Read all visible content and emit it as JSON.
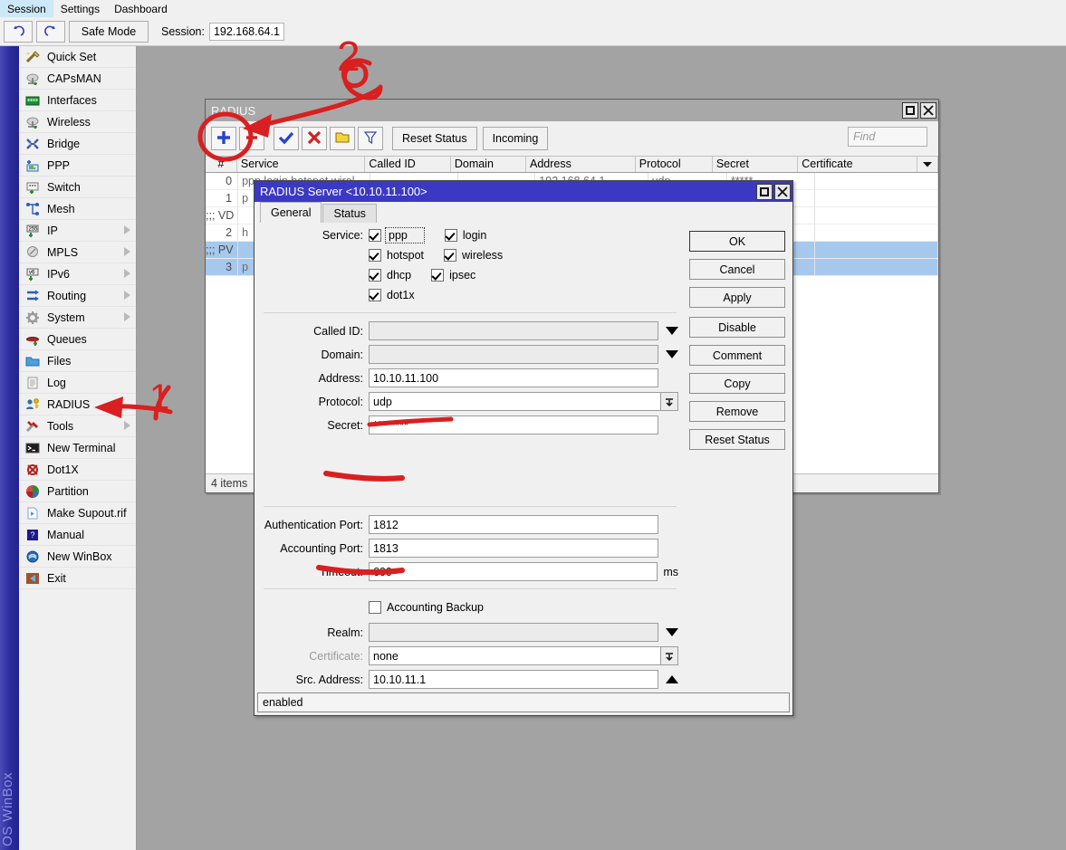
{
  "menubar": {
    "items": [
      "Session",
      "Settings",
      "Dashboard"
    ],
    "active_index": 0
  },
  "toolbar": {
    "undo_icon": "undo-arrow-icon",
    "redo_icon": "redo-arrow-icon",
    "safe_mode_label": "Safe Mode",
    "session_label": "Session:",
    "session_value": "192.168.64.1"
  },
  "brand_strip": {
    "text": "OS WinBox"
  },
  "sidebar": {
    "items": [
      {
        "label": "Quick Set",
        "icon": "wand-icon",
        "submenu": false
      },
      {
        "label": "CAPsMAN",
        "icon": "antenna-icon",
        "submenu": false
      },
      {
        "label": "Interfaces",
        "icon": "chip-icon",
        "submenu": false
      },
      {
        "label": "Wireless",
        "icon": "antenna-icon",
        "submenu": false
      },
      {
        "label": "Bridge",
        "icon": "bridge-icon",
        "submenu": false
      },
      {
        "label": "PPP",
        "icon": "ppp-icon",
        "submenu": false
      },
      {
        "label": "Switch",
        "icon": "switch-icon",
        "submenu": false
      },
      {
        "label": "Mesh",
        "icon": "mesh-icon",
        "submenu": false
      },
      {
        "label": "IP",
        "icon": "ip-icon",
        "submenu": true
      },
      {
        "label": "MPLS",
        "icon": "mpls-icon",
        "submenu": true
      },
      {
        "label": "IPv6",
        "icon": "ipv6-icon",
        "submenu": true
      },
      {
        "label": "Routing",
        "icon": "routing-icon",
        "submenu": true
      },
      {
        "label": "System",
        "icon": "gear-icon",
        "submenu": true
      },
      {
        "label": "Queues",
        "icon": "queues-icon",
        "submenu": false
      },
      {
        "label": "Files",
        "icon": "folder-icon",
        "submenu": false
      },
      {
        "label": "Log",
        "icon": "log-icon",
        "submenu": false
      },
      {
        "label": "RADIUS",
        "icon": "radius-key-icon",
        "submenu": false
      },
      {
        "label": "Tools",
        "icon": "tools-icon",
        "submenu": true
      },
      {
        "label": "New Terminal",
        "icon": "terminal-icon",
        "submenu": false
      },
      {
        "label": "Dot1X",
        "icon": "dot1x-icon",
        "submenu": false
      },
      {
        "label": "Partition",
        "icon": "partition-icon",
        "submenu": false
      },
      {
        "label": "Make Supout.rif",
        "icon": "supout-icon",
        "submenu": false
      },
      {
        "label": "Manual",
        "icon": "manual-icon",
        "submenu": false
      },
      {
        "label": "New WinBox",
        "icon": "winbox-icon",
        "submenu": false
      },
      {
        "label": "Exit",
        "icon": "exit-icon",
        "submenu": false
      }
    ]
  },
  "radius_window": {
    "title": "RADIUS",
    "maximize_icon": "maximize-icon",
    "close_icon": "close-icon",
    "toolbar": {
      "add_icon": "plus-icon",
      "remove_icon": "minus-icon",
      "enable_icon": "check-icon",
      "disable_icon": "cross-icon",
      "comment_icon": "note-icon",
      "filter_icon": "funnel-icon",
      "reset_status_label": "Reset Status",
      "incoming_label": "Incoming",
      "find_placeholder": "Find"
    },
    "columns": [
      "#",
      "Service",
      "Called ID",
      "Domain",
      "Address",
      "Protocol",
      "Secret",
      "Certificate"
    ],
    "rows": [
      {
        "num": "0",
        "service": "ppp login hotspot wirel",
        "called_id": "",
        "domain": "",
        "address": "192.168.64.1",
        "protocol": "udp",
        "secret": "*****",
        "certificate": "",
        "selected": false,
        "comment": false
      },
      {
        "num": "1",
        "service": "p",
        "called_id": "",
        "domain": "",
        "address": "",
        "protocol": "",
        "secret": "",
        "certificate": "",
        "selected": false,
        "comment": false
      },
      {
        "num": ";;; VD",
        "service": "",
        "called_id": "",
        "domain": "",
        "address": "",
        "protocol": "",
        "secret": "",
        "certificate": "",
        "selected": false,
        "comment": true
      },
      {
        "num": "2",
        "service": "h",
        "called_id": "",
        "domain": "",
        "address": "",
        "protocol": "",
        "secret": "",
        "certificate": "",
        "selected": false,
        "comment": false
      },
      {
        "num": ";;; PV",
        "service": "",
        "called_id": "",
        "domain": "",
        "address": "",
        "protocol": "",
        "secret": "",
        "certificate": "",
        "selected": true,
        "comment": true
      },
      {
        "num": "3",
        "service": "p",
        "called_id": "",
        "domain": "",
        "address": "",
        "protocol": "",
        "secret": "",
        "certificate": "",
        "selected": true,
        "comment": false
      }
    ],
    "item_count": "4 items"
  },
  "dialog": {
    "title": "RADIUS Server <10.10.11.100>",
    "maximize_icon": "maximize-icon",
    "close_icon": "close-icon",
    "tabs": [
      {
        "label": "General",
        "active": true
      },
      {
        "label": "Status",
        "active": false
      }
    ],
    "service": {
      "label": "Service:",
      "checkboxes": [
        {
          "label": "ppp",
          "checked": true,
          "focused": true
        },
        {
          "label": "login",
          "checked": true,
          "focused": false
        },
        {
          "label": "hotspot",
          "checked": true,
          "focused": false
        },
        {
          "label": "wireless",
          "checked": true,
          "focused": false
        },
        {
          "label": "dhcp",
          "checked": true,
          "focused": false
        },
        {
          "label": "ipsec",
          "checked": true,
          "focused": false
        },
        {
          "label": "dot1x",
          "checked": true,
          "focused": false
        }
      ]
    },
    "fields": [
      {
        "label": "Called ID:",
        "value": "",
        "kind": "combo",
        "dim": false
      },
      {
        "label": "Domain:",
        "value": "",
        "kind": "combo",
        "dim": false
      },
      {
        "label": "Address:",
        "value": "10.10.11.100",
        "kind": "text",
        "dim": false
      },
      {
        "label": "Protocol:",
        "value": "udp",
        "kind": "select",
        "dim": false
      },
      {
        "label": "Secret:",
        "value": "********",
        "kind": "text",
        "dim": false
      }
    ],
    "port_fields": [
      {
        "label": "Authentication Port:",
        "value": "1812",
        "unit": ""
      },
      {
        "label": "Accounting Port:",
        "value": "1813",
        "unit": ""
      },
      {
        "label": "Timeout:",
        "value": "600",
        "unit": "ms"
      }
    ],
    "accounting_backup": {
      "label": "Accounting Backup",
      "checked": false
    },
    "tail_fields": [
      {
        "label": "Realm:",
        "value": "",
        "kind": "combo",
        "dim": false
      },
      {
        "label": "Certificate:",
        "value": "none",
        "kind": "select",
        "dim": true
      },
      {
        "label": "Src. Address:",
        "value": "10.10.11.1",
        "kind": "up",
        "dim": false
      }
    ],
    "buttons": [
      {
        "label": "OK",
        "primary": true,
        "gap": false
      },
      {
        "label": "Cancel",
        "primary": false,
        "gap": false
      },
      {
        "label": "Apply",
        "primary": false,
        "gap": false
      },
      {
        "label": "Disable",
        "primary": false,
        "gap": true
      },
      {
        "label": "Comment",
        "primary": false,
        "gap": false
      },
      {
        "label": "Copy",
        "primary": false,
        "gap": false
      },
      {
        "label": "Remove",
        "primary": false,
        "gap": false
      },
      {
        "label": "Reset Status",
        "primary": false,
        "gap": false
      }
    ],
    "status_text": "enabled"
  },
  "annotations": [
    {
      "name": "callout-1",
      "label": "1",
      "color": "#d91f1f"
    },
    {
      "name": "callout-2",
      "label": "2",
      "color": "#d91f1f"
    }
  ],
  "colors": {
    "desktop": "#a3a3a3",
    "dialog_titlebar": "#3b39c4",
    "window_titlebar": "#a8a8a8",
    "selection": "#a6c8ec",
    "annotation": "#d91f1f",
    "brand_strip": "#2b2b9e"
  }
}
